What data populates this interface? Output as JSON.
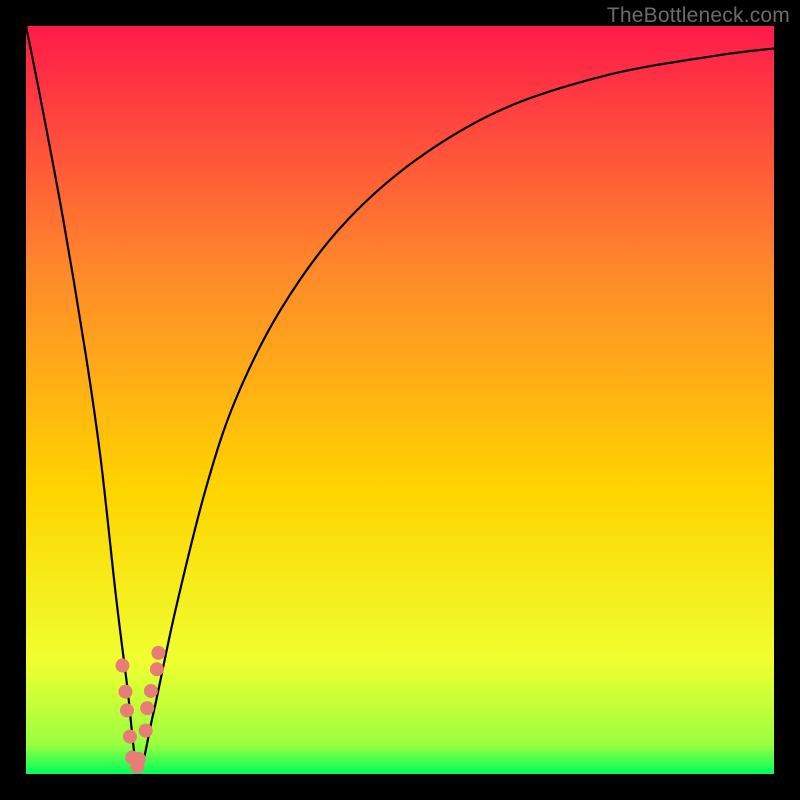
{
  "attribution": "TheBottleneck.com",
  "colors": {
    "bg": "#000000",
    "curve": "#000000",
    "points": "#e77d76",
    "gradient_top": "#ff1a4a",
    "gradient_mid_upper": "#ff7a30",
    "gradient_mid": "#ffd400",
    "gradient_mid_lower": "#f8ff22",
    "gradient_bottom": "#00ff5a"
  },
  "chart_data": {
    "type": "line",
    "title": "",
    "xlabel": "",
    "ylabel": "",
    "xlim": [
      0,
      100
    ],
    "ylim": [
      0,
      100
    ],
    "grid": false,
    "series": [
      {
        "name": "bottleneck-curve",
        "comment": "approximate y (0=bottom green, 100=top red) vs x (0..100)",
        "x": [
          0,
          2,
          5,
          8,
          10,
          12,
          13.5,
          15,
          17,
          20,
          24,
          28,
          34,
          42,
          52,
          64,
          78,
          92,
          100
        ],
        "y": [
          100,
          90,
          74,
          56,
          42,
          24,
          12,
          0.5,
          8,
          22,
          38,
          50,
          62,
          73,
          82,
          89,
          93.5,
          96,
          97
        ]
      }
    ],
    "scatter": {
      "name": "highlight-points",
      "comment": "coral dots clustered near the curve bottom",
      "x": [
        12.9,
        13.3,
        13.5,
        13.9,
        14.2,
        14.9,
        15.1,
        16.0,
        16.2,
        16.7,
        17.5,
        17.7
      ],
      "y": [
        14.5,
        11.0,
        8.5,
        5.0,
        2.2,
        1.0,
        2.0,
        5.8,
        8.8,
        11.1,
        14.0,
        16.2
      ]
    }
  }
}
